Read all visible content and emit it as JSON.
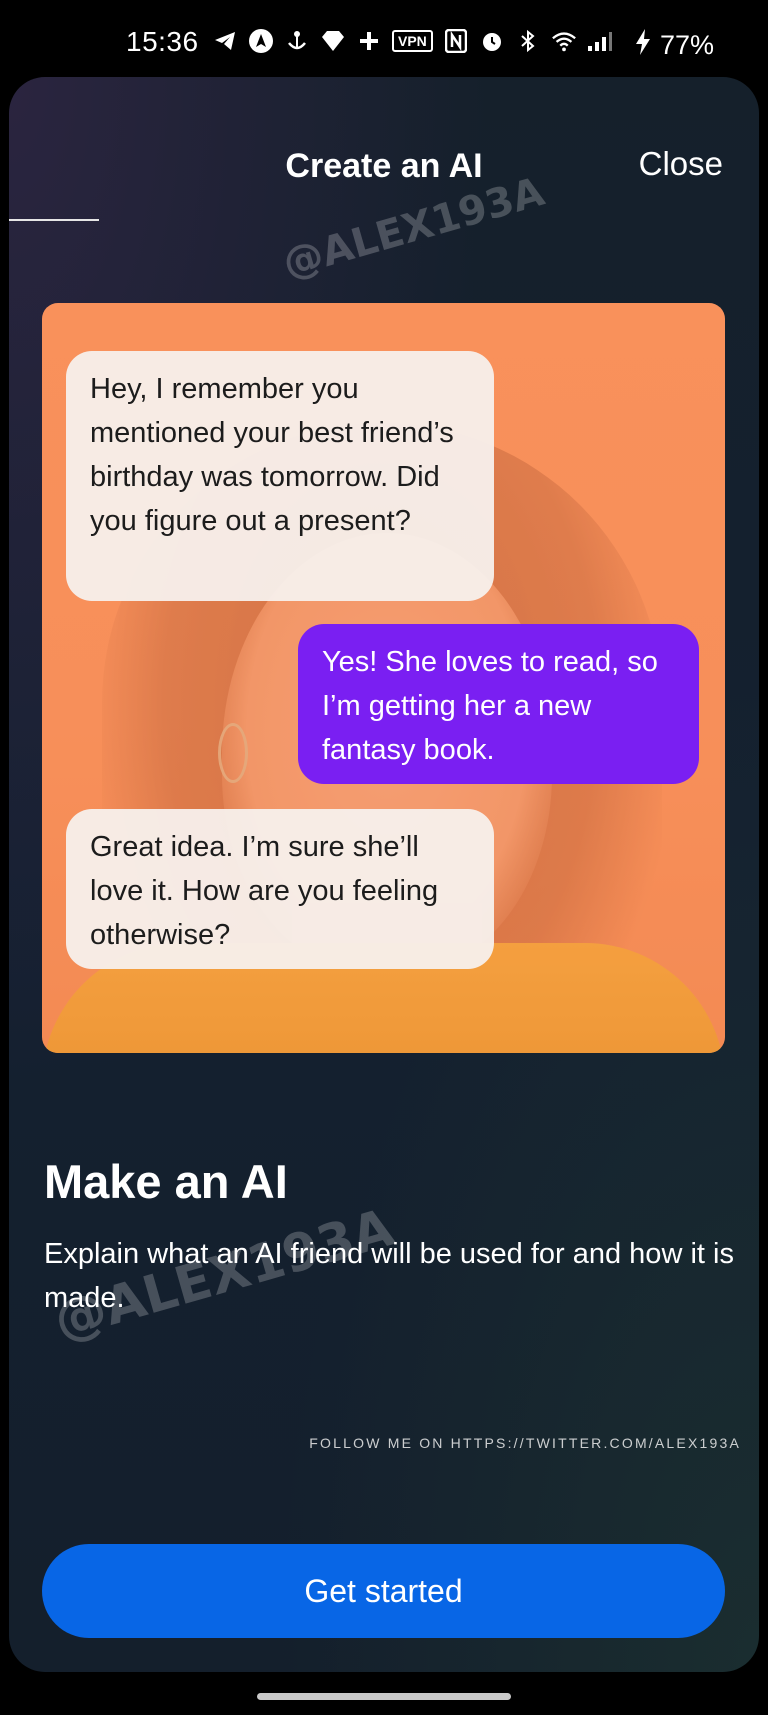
{
  "status_bar": {
    "time": "15:36",
    "vpn_label": "VPN",
    "battery_percent": "77%"
  },
  "header": {
    "title": "Create an AI",
    "close_label": "Close",
    "progress": 0.12
  },
  "watermark": {
    "handle": "@ALEX193A"
  },
  "hero_chat": {
    "messages": [
      {
        "from": "ai",
        "text": "Hey, I remember you mentioned your best friend’s birthday was tomorrow. Did you figure out a present?"
      },
      {
        "from": "user",
        "text": "Yes! She loves to read, so I’m getting her a new fantasy book."
      },
      {
        "from": "ai",
        "text": "Great idea. I’m sure she’ll love it. How are you feeling otherwise?"
      }
    ]
  },
  "content": {
    "heading": "Make an AI",
    "description": "Explain what an AI friend will be used for and how it is made.",
    "follow_text": "FOLLOW ME ON HTTPS://TWITTER.COM/ALEX193A"
  },
  "cta": {
    "label": "Get started"
  },
  "colors": {
    "accent_button": "#0866e6",
    "user_bubble": "#7a1ff2",
    "hero_background": "#f7935f"
  }
}
